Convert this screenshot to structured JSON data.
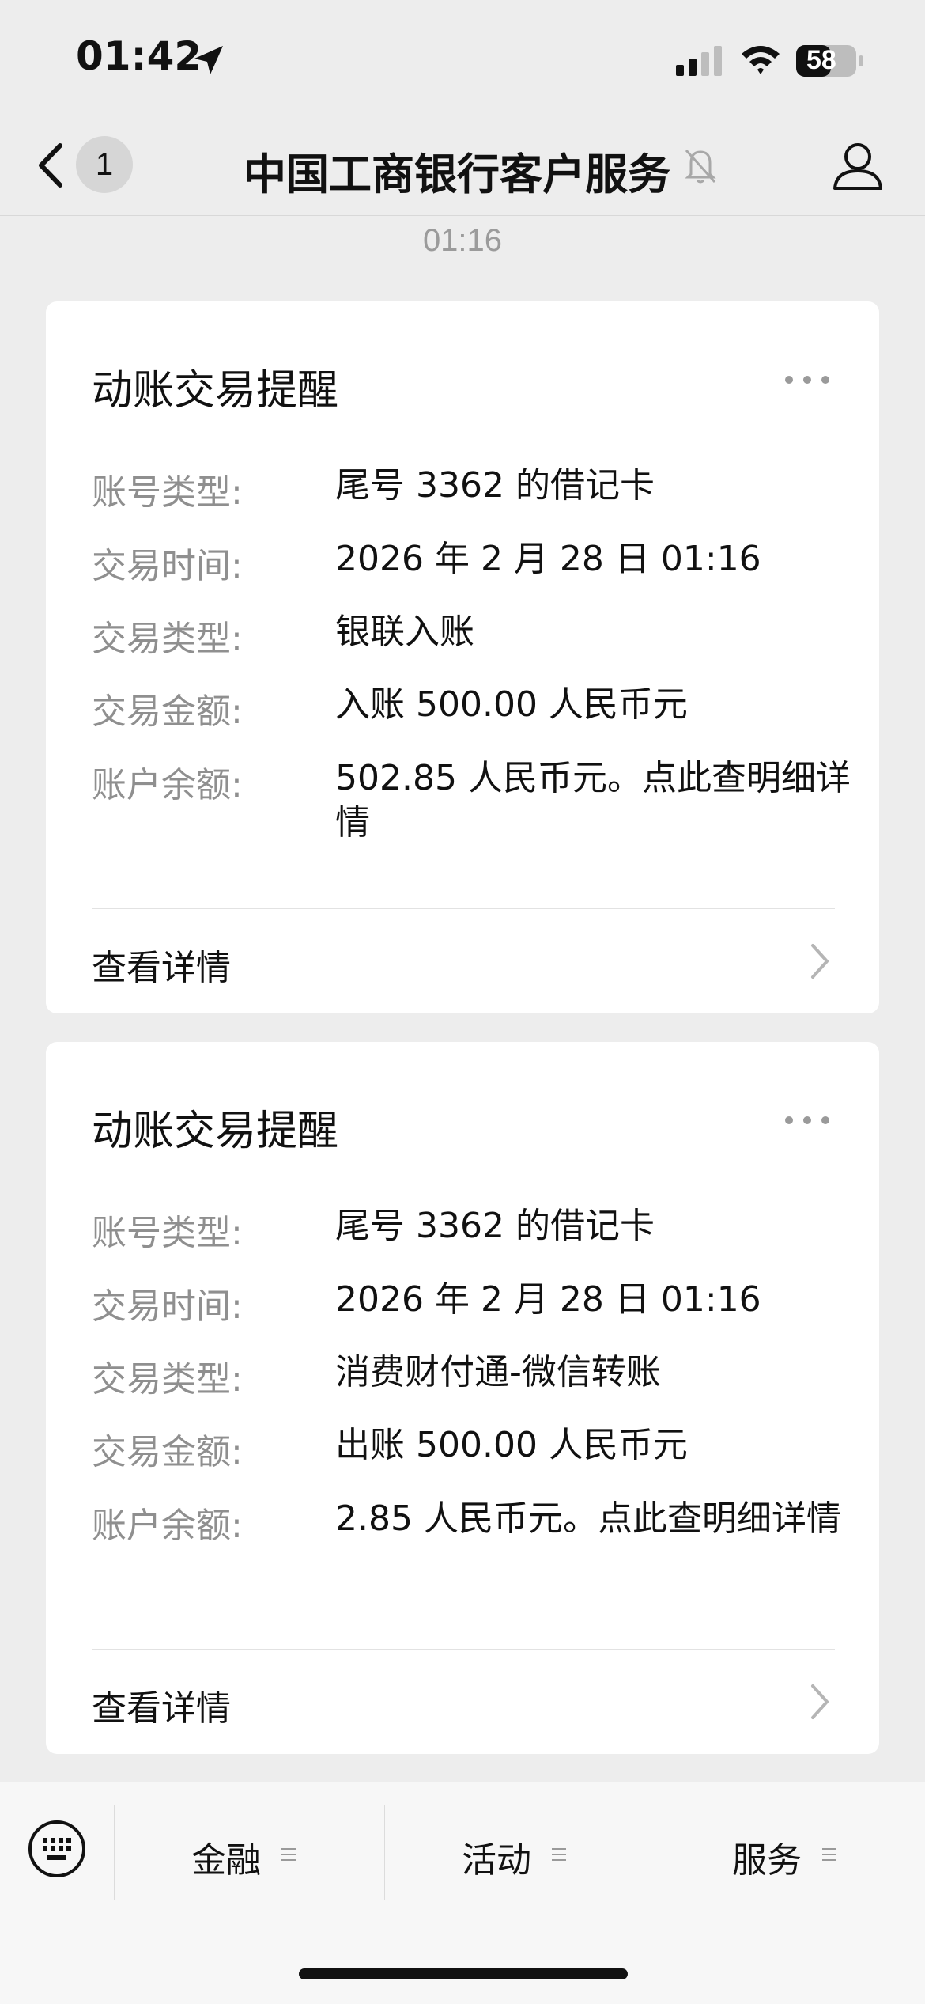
{
  "status_bar": {
    "time": "01:42",
    "battery": "58"
  },
  "nav": {
    "unread_count": "1",
    "title": "中国工商银行客户服务"
  },
  "timestamp": "01:16",
  "cards": [
    {
      "title": "动账交易提醒",
      "fields": [
        {
          "label": "账号类型:",
          "value": "尾号 3362 的借记卡"
        },
        {
          "label": "交易时间:",
          "value": "2026 年 2 月 28 日 01:16"
        },
        {
          "label": "交易类型:",
          "value": "银联入账"
        },
        {
          "label": "交易金额:",
          "value": "入账 500.00 人民币元"
        },
        {
          "label": "账户余额:",
          "value": "502.85 人民币元。点此查明细详情"
        }
      ],
      "detail_label": "查看详情"
    },
    {
      "title": "动账交易提醒",
      "fields": [
        {
          "label": "账号类型:",
          "value": "尾号 3362 的借记卡"
        },
        {
          "label": "交易时间:",
          "value": "2026 年 2 月 28 日 01:16"
        },
        {
          "label": "交易类型:",
          "value": "消费财付通-微信转账"
        },
        {
          "label": "交易金额:",
          "value": "出账 500.00 人民币元"
        },
        {
          "label": "账户余额:",
          "value": "2.85 人民币元。点此查明细详情"
        }
      ],
      "detail_label": "查看详情"
    }
  ],
  "bottom_menu": {
    "items": [
      {
        "label": "金融"
      },
      {
        "label": "活动"
      },
      {
        "label": "服务"
      }
    ]
  }
}
